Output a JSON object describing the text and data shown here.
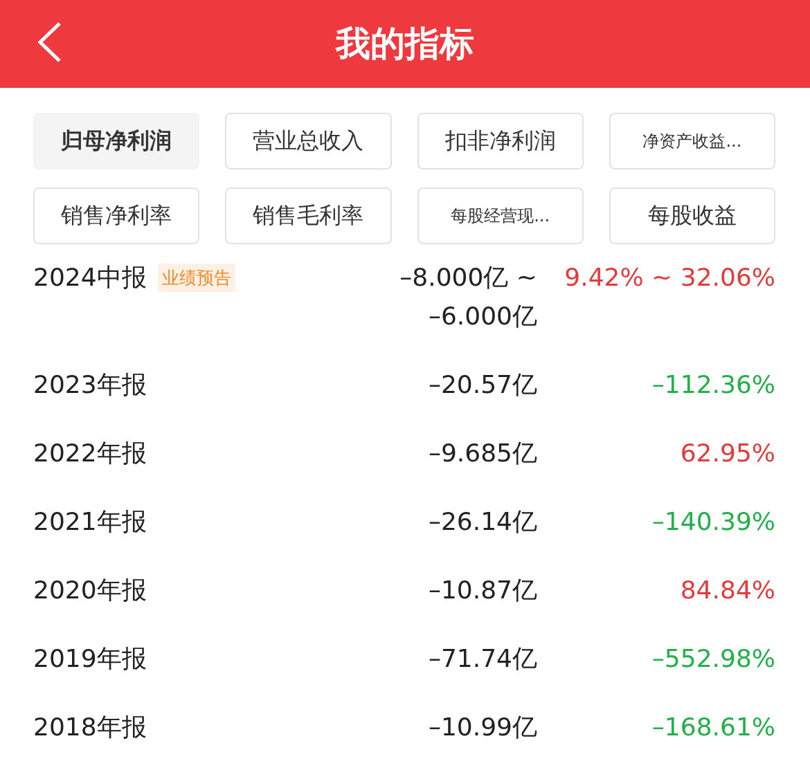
{
  "header": {
    "title": "我的指标"
  },
  "tabs": [
    {
      "label": "归母净利润",
      "selected": true,
      "kind": "full"
    },
    {
      "label": "营业总收入",
      "selected": false,
      "kind": "full"
    },
    {
      "label": "扣非净利润",
      "selected": false,
      "kind": "full"
    },
    {
      "label": "净资产收益...",
      "selected": false,
      "kind": "truncated"
    },
    {
      "label": "销售净利率",
      "selected": false,
      "kind": "full"
    },
    {
      "label": "销售毛利率",
      "selected": false,
      "kind": "full"
    },
    {
      "label": "每股经营现...",
      "selected": false,
      "kind": "truncated"
    },
    {
      "label": "每股收益",
      "selected": false,
      "kind": "full"
    }
  ],
  "rows": [
    {
      "period": "2024中报",
      "badge": "业绩预告",
      "value": [
        "–8.000亿 ~",
        "–6.000亿"
      ],
      "change": "9.42% ~ 32.06%",
      "color": "#e33b3b"
    },
    {
      "period": "2023年报",
      "value": [
        "–20.57亿"
      ],
      "change": "–112.36%",
      "color": "#22b04a"
    },
    {
      "period": "2022年报",
      "value": [
        "–9.685亿"
      ],
      "change": "62.95%",
      "color": "#e33b3b"
    },
    {
      "period": "2021年报",
      "value": [
        "–26.14亿"
      ],
      "change": "–140.39%",
      "color": "#22b04a"
    },
    {
      "period": "2020年报",
      "value": [
        "–10.87亿"
      ],
      "change": "84.84%",
      "color": "#e33b3b"
    },
    {
      "period": "2019年报",
      "value": [
        "–71.74亿"
      ],
      "change": "–552.98%",
      "color": "#22b04a"
    },
    {
      "period": "2018年报",
      "value": [
        "–10.99亿"
      ],
      "change": "–168.61%",
      "color": "#22b04a"
    }
  ]
}
